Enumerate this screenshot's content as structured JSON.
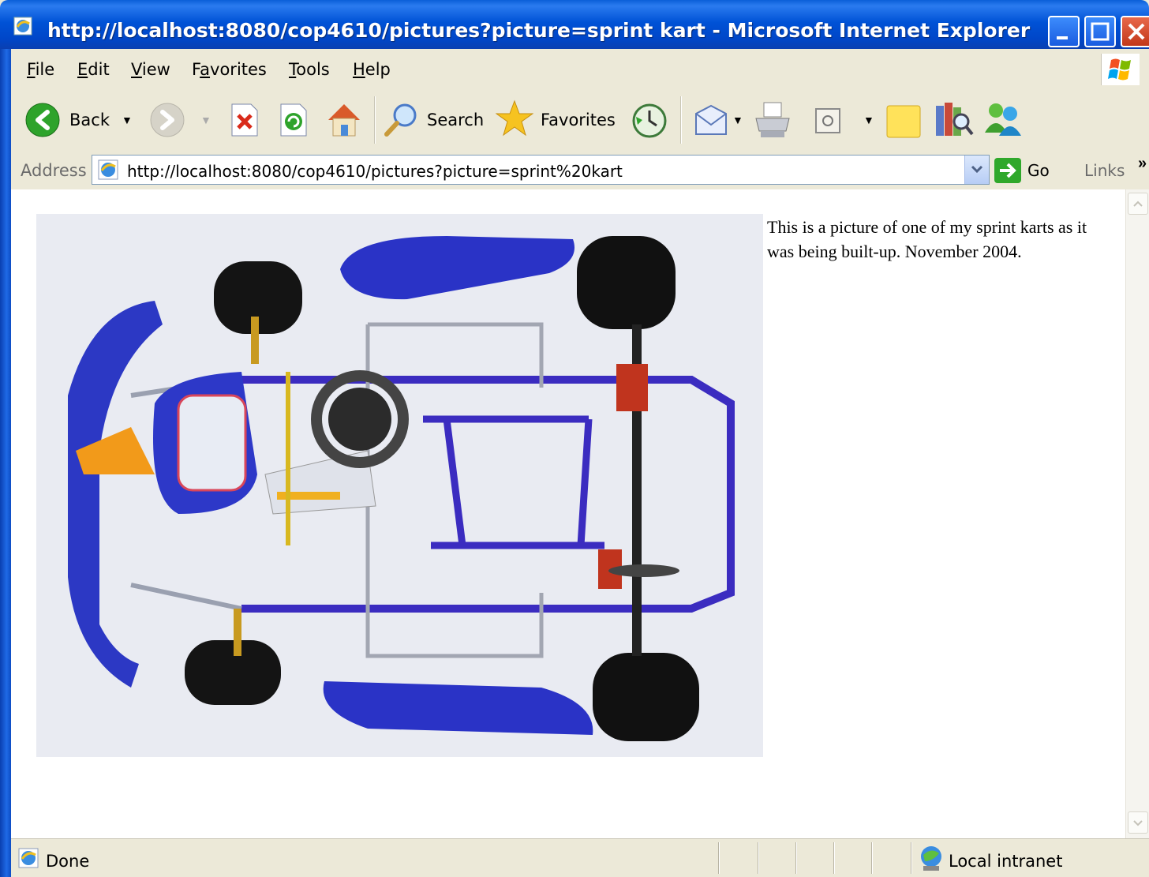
{
  "window": {
    "title": "http://localhost:8080/cop4610/pictures?picture=sprint kart - Microsoft Internet Explorer"
  },
  "menu": [
    {
      "key": "F",
      "rest": "ile"
    },
    {
      "key": "E",
      "rest": "dit"
    },
    {
      "key": "V",
      "rest": "iew"
    },
    {
      "pre": "F",
      "key": "a",
      "rest": "vorites"
    },
    {
      "key": "T",
      "rest": "ools"
    },
    {
      "key": "H",
      "rest": "elp"
    }
  ],
  "toolbar": {
    "back_label": "Back",
    "search_label": "Search",
    "favorites_label": "Favorites"
  },
  "address": {
    "label": "Address",
    "value": "http://localhost:8080/cop4610/pictures?picture=sprint%20kart",
    "go_label": "Go",
    "links_label": "Links"
  },
  "content": {
    "caption": "This is a picture of one of my sprint karts as it was being built-up. November 2004."
  },
  "status": {
    "text": "Done",
    "zone": "Local intranet"
  },
  "colors": {
    "titlebar": "#0052d6",
    "chrome": "#ece9d8",
    "kart_blue": "#2633b8"
  }
}
